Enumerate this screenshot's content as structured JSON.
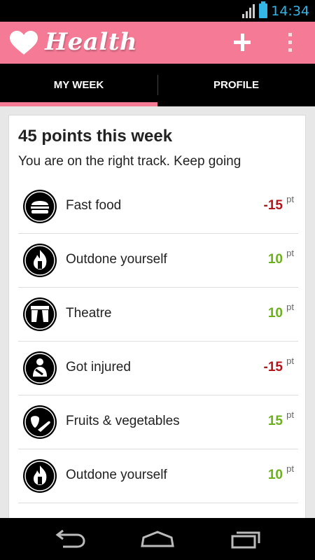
{
  "status": {
    "time": "14:34"
  },
  "app": {
    "title": "Health"
  },
  "tabs": [
    {
      "label": "MY WEEK",
      "selected": true
    },
    {
      "label": "PROFILE",
      "selected": false
    }
  ],
  "summary": {
    "title": "45 points this week",
    "subtitle": "You are on the right track. Keep going"
  },
  "unit": "pt",
  "activities": [
    {
      "label": "Fast food",
      "points": "-15",
      "icon": "burger-icon",
      "type": "neg"
    },
    {
      "label": "Outdone yourself",
      "points": "10",
      "icon": "flame-icon",
      "type": "pos"
    },
    {
      "label": "Theatre",
      "points": "10",
      "icon": "theatre-icon",
      "type": "pos"
    },
    {
      "label": "Got injured",
      "points": "-15",
      "icon": "injury-icon",
      "type": "neg"
    },
    {
      "label": "Fruits & vegetables",
      "points": "15",
      "icon": "fruit-icon",
      "type": "pos"
    },
    {
      "label": "Outdone yourself",
      "points": "10",
      "icon": "flame-icon",
      "type": "pos"
    }
  ],
  "colors": {
    "accent": "#f57a96",
    "negative": "#b3161a",
    "positive": "#6cb01e",
    "status": "#33b5e5"
  }
}
